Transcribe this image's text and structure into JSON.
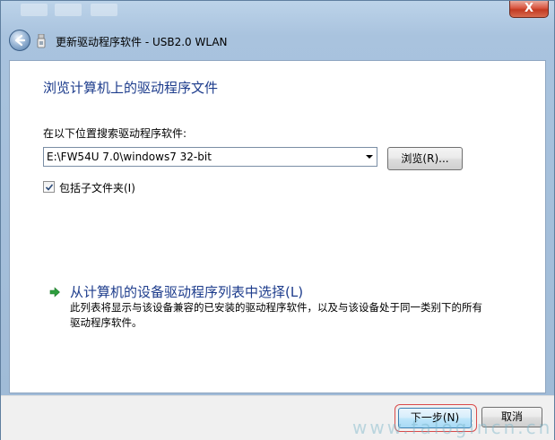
{
  "window": {
    "close_label": "X"
  },
  "nav": {
    "title": "更新驱动程序软件 - USB2.0 WLAN"
  },
  "main": {
    "heading": "浏览计算机上的驱动程序文件",
    "search_label": "在以下位置搜索驱动程序软件:",
    "path_value": "E:\\FW54U 7.0\\windows7 32-bit",
    "browse_label": "浏览(R)...",
    "include_subfolders_label": "包括子文件夹(I)",
    "include_subfolders_checked": true,
    "pick_link_title": "从计算机的设备驱动程序列表中选择(L)",
    "pick_link_desc": "此列表将显示与该设备兼容的已安装的驱动程序软件，以及与该设备处于同一类别下的所有驱动程序软件。"
  },
  "footer": {
    "next_label": "下一步(N)",
    "cancel_label": "取消"
  },
  "watermark": "www.falogincn.cn",
  "colors": {
    "heading_blue": "#1d3c8c",
    "highlight_red": "#d94b4b",
    "arrow_green": "#2e9e3e"
  }
}
